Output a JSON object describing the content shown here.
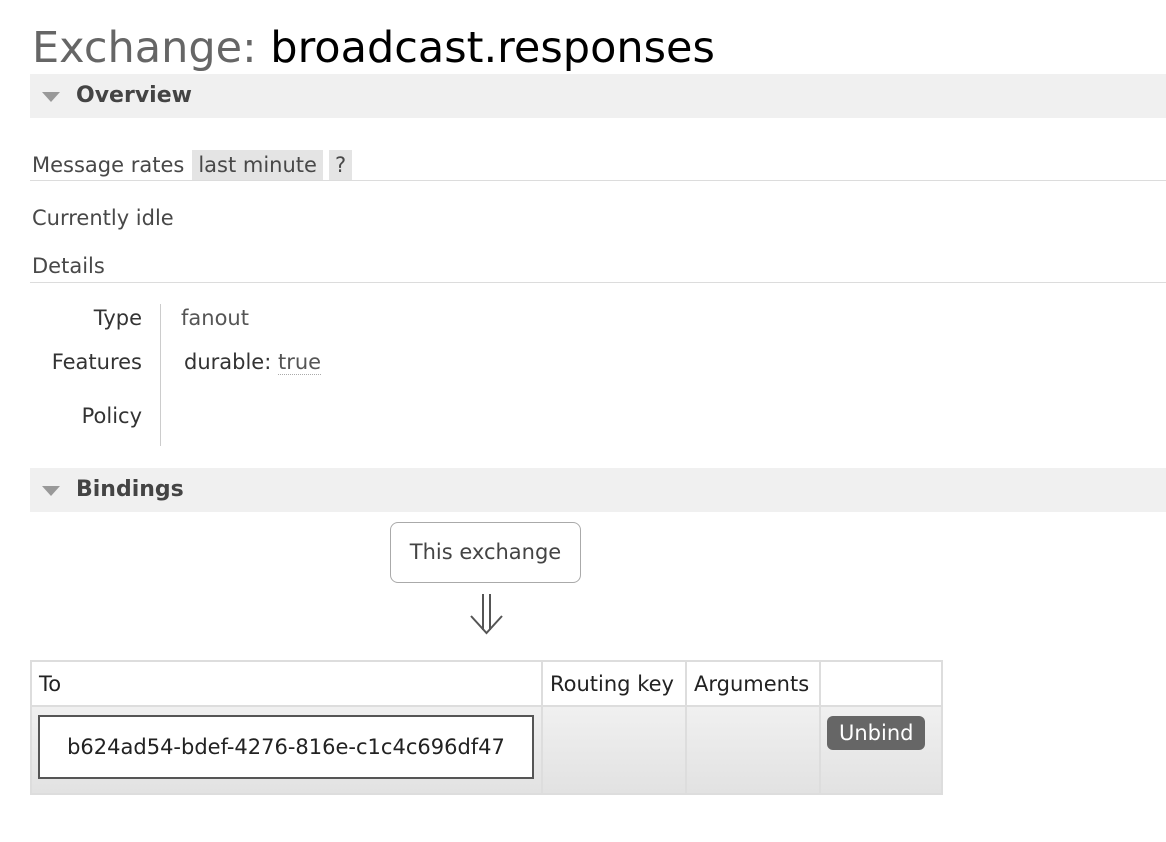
{
  "page": {
    "title_prefix": "Exchange:",
    "title_name": "broadcast.responses"
  },
  "overview": {
    "section_label": "Overview",
    "message_rates_label": "Message rates",
    "rate_period": "last minute",
    "help_label": "?",
    "idle_text": "Currently idle",
    "details_label": "Details",
    "details": {
      "type_key": "Type",
      "type_value": "fanout",
      "features_key": "Features",
      "features_durable_key": "durable:",
      "features_durable_value": "true",
      "policy_key": "Policy",
      "policy_value": ""
    }
  },
  "bindings": {
    "section_label": "Bindings",
    "source_label": "This exchange",
    "table": {
      "headers": [
        "To",
        "Routing key",
        "Arguments",
        ""
      ],
      "rows": [
        {
          "to": "b624ad54-bdef-4276-816e-c1c4c696df47",
          "routing_key": "",
          "arguments": "",
          "action_label": "Unbind"
        }
      ]
    }
  },
  "icons": {
    "section_toggle": "triangle-down-icon",
    "flow_arrow": "double-arrow-down-icon"
  },
  "colors": {
    "section_bar": "#f0f0f0",
    "button_bg": "#666666",
    "table_border": "#dddddd"
  }
}
